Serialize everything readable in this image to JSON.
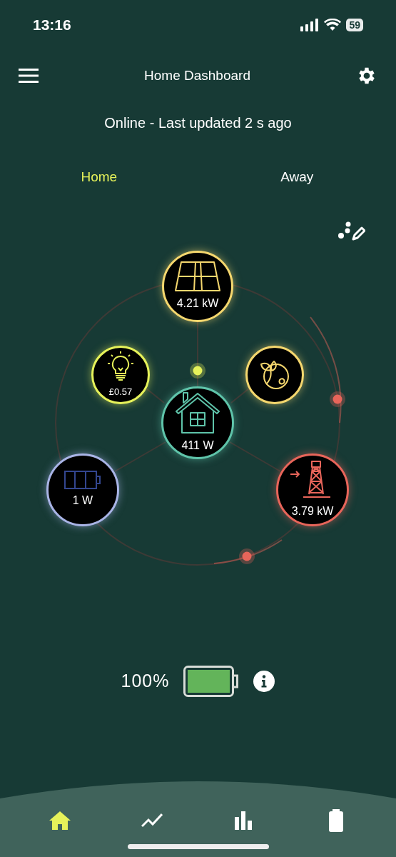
{
  "status_bar": {
    "time": "13:16",
    "battery": "59"
  },
  "header": {
    "title": "Home Dashboard"
  },
  "connection_status": "Online - Last updated 2 s ago",
  "tabs": [
    {
      "label": "Home",
      "selected": true
    },
    {
      "label": "Away",
      "selected": false
    }
  ],
  "nodes": [
    {
      "kind": "solar",
      "value": "4.21 kW",
      "color": "#f5d76e"
    },
    {
      "kind": "cost",
      "value": "£0.57",
      "color": "#e6f25a"
    },
    {
      "kind": "eco",
      "color": "#f5d76e"
    },
    {
      "kind": "home",
      "value": "411 W",
      "color": "#5fc4aa"
    },
    {
      "kind": "battery",
      "value": "1 W",
      "color": "#a9b4e6"
    },
    {
      "kind": "grid",
      "value": "3.79 kW",
      "color": "#e8655a"
    }
  ],
  "battery_summary": {
    "percent": "100%"
  },
  "bottom_nav": [
    {
      "kind": "home",
      "selected": true
    },
    {
      "kind": "trend",
      "selected": false
    },
    {
      "kind": "bars",
      "selected": false
    },
    {
      "kind": "battery",
      "selected": false
    }
  ]
}
